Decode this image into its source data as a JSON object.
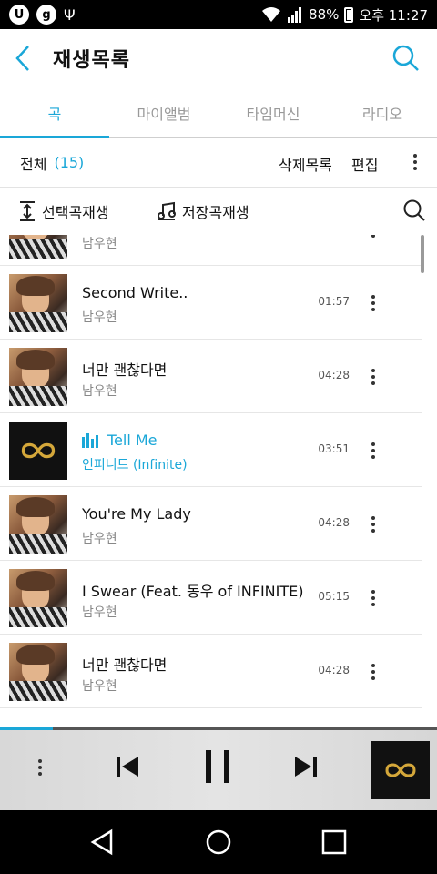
{
  "status_bar": {
    "left_icons": [
      "u-plus-icon",
      "g-icon",
      "usb-icon"
    ],
    "battery": "88%",
    "time": "오후 11:27",
    "icons": [
      "wifi-icon",
      "signal-icon",
      "battery-icon"
    ]
  },
  "header": {
    "title": "재생목록"
  },
  "tabs": [
    {
      "label": "곡",
      "active": true
    },
    {
      "label": "마이앨범",
      "active": false
    },
    {
      "label": "타임머신",
      "active": false
    },
    {
      "label": "라디오",
      "active": false
    }
  ],
  "list_bar": {
    "all_label": "전체",
    "count": "(15)",
    "delete_list": "삭제목록",
    "edit": "편집"
  },
  "play_bar": {
    "play_selected": "선택곡재생",
    "play_saved": "저장곡재생"
  },
  "songs": [
    {
      "title": "",
      "artist": "남우현",
      "duration": "",
      "thumb": "photo",
      "playing": false
    },
    {
      "title": "Second Write..",
      "artist": "남우현",
      "duration": "01:57",
      "thumb": "photo",
      "playing": false
    },
    {
      "title": "너만 괜찮다면",
      "artist": "남우현",
      "duration": "04:28",
      "thumb": "photo",
      "playing": false
    },
    {
      "title": "Tell Me",
      "artist": "인피니트 (Infinite)",
      "duration": "03:51",
      "thumb": "infinite-logo",
      "playing": true
    },
    {
      "title": "You're My Lady",
      "artist": "남우현",
      "duration": "04:28",
      "thumb": "photo",
      "playing": false
    },
    {
      "title": "I Swear (Feat. 동우 of INFINITE)",
      "artist": "남우현",
      "duration": "05:15",
      "thumb": "photo",
      "playing": false
    },
    {
      "title": "너만 괜찮다면",
      "artist": "남우현",
      "duration": "04:28",
      "thumb": "photo",
      "playing": false
    }
  ],
  "player": {
    "progress_fraction": 0.12,
    "accent": "#1aa7d8",
    "album_art": "infinite-logo"
  },
  "colors": {
    "accent": "#1aa7d8",
    "text": "#111111",
    "muted": "#888888"
  }
}
